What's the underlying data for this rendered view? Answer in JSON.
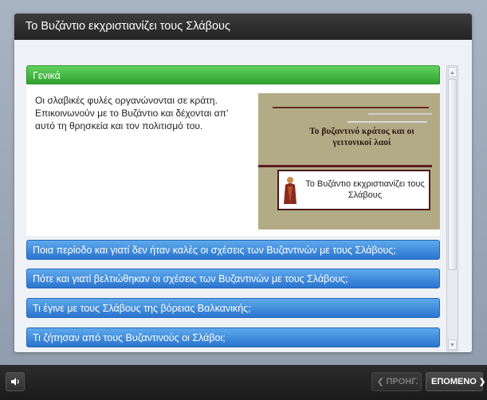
{
  "window": {
    "title": "Το Βυζάντιο εκχριστιανίζει τους Σλάβους"
  },
  "accordion": {
    "expanded": {
      "label": "Γενικά",
      "text": "Οι σλαβικές φυλές οργανώνονται σε κράτη. Επικοινωνούν με το Βυζάντιο και δέχονται απ’ αυτό τη θρησκεία και τον πολιτισμό του.",
      "thumbnail_title": "Το βυζαντινό κράτος και οι γειτονικοί λαοί",
      "thumbnail_caption": "Το Βυζάντιο εκχριστιανίζει τους Σλάβους"
    },
    "items": [
      {
        "label": "Ποια περίοδο και γιατί δεν ήταν καλές οι σχέσεις των Βυζαντινών με τους Σλάβους;"
      },
      {
        "label": "Πότε και γιατί βελτιώθηκαν οι σχέσεις των Βυζαντινών με τους Σλάβους;"
      },
      {
        "label": "Τι έγινε με τους Σλάβους της βόρειας Βαλκανικής;"
      },
      {
        "label": "Τι ζήτησαν από τους Βυζαντινούς οι Σλάβοι;"
      }
    ]
  },
  "footer": {
    "prev_label": "ΠΡΟΗΓ.",
    "next_label": "ΕΠΟΜΕΝΟ",
    "volume_icon": "speaker-icon"
  },
  "colors": {
    "expanded_header": "#3cb23a",
    "item_header": "#3a86dc",
    "title_bar": "#2e2e2e",
    "footer": "#222222"
  }
}
